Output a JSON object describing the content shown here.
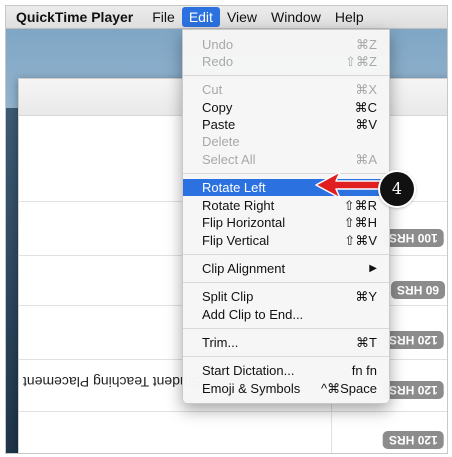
{
  "menubar": {
    "app_name": "QuickTime Player",
    "items": [
      "File",
      "Edit",
      "View",
      "Window",
      "Help"
    ]
  },
  "edit_menu": {
    "undo": {
      "label": "Undo",
      "shortcut": "⌘Z"
    },
    "redo": {
      "label": "Redo",
      "shortcut": "⇧⌘Z"
    },
    "cut": {
      "label": "Cut",
      "shortcut": "⌘X"
    },
    "copy": {
      "label": "Copy",
      "shortcut": "⌘C"
    },
    "paste": {
      "label": "Paste",
      "shortcut": "⌘V"
    },
    "delete": {
      "label": "Delete"
    },
    "select_all": {
      "label": "Select All",
      "shortcut": "⌘A"
    },
    "rotate_left": {
      "label": "Rotate Left"
    },
    "rotate_right": {
      "label": "Rotate Right",
      "shortcut": "⇧⌘R"
    },
    "flip_horizontal": {
      "label": "Flip Horizontal",
      "shortcut": "⇧⌘H"
    },
    "flip_vertical": {
      "label": "Flip Vertical",
      "shortcut": "⇧⌘V"
    },
    "clip_alignment": {
      "label": "Clip Alignment",
      "submenu_icon": "chevron-right-icon"
    },
    "split_clip": {
      "label": "Split Clip",
      "shortcut": "⌘Y"
    },
    "add_clip": {
      "label": "Add Clip to End..."
    },
    "trim": {
      "label": "Trim...",
      "shortcut": "⌘T"
    },
    "start_dictation": {
      "label": "Start Dictation...",
      "shortcut": "fn fn"
    },
    "emoji": {
      "label": "Emoji & Symbols",
      "shortcut": "^⌘Space"
    }
  },
  "background": {
    "hour_pills": [
      "100 HRS",
      "60 HRS",
      "120 HRS",
      "120 HRS",
      "120 HRS"
    ],
    "row_text": "Student Teaching Placement"
  },
  "callout": {
    "step_number": "4",
    "color": "#e02020"
  },
  "colors": {
    "highlight": "#2b71e0",
    "disabled_text": "#a8a8a8"
  }
}
